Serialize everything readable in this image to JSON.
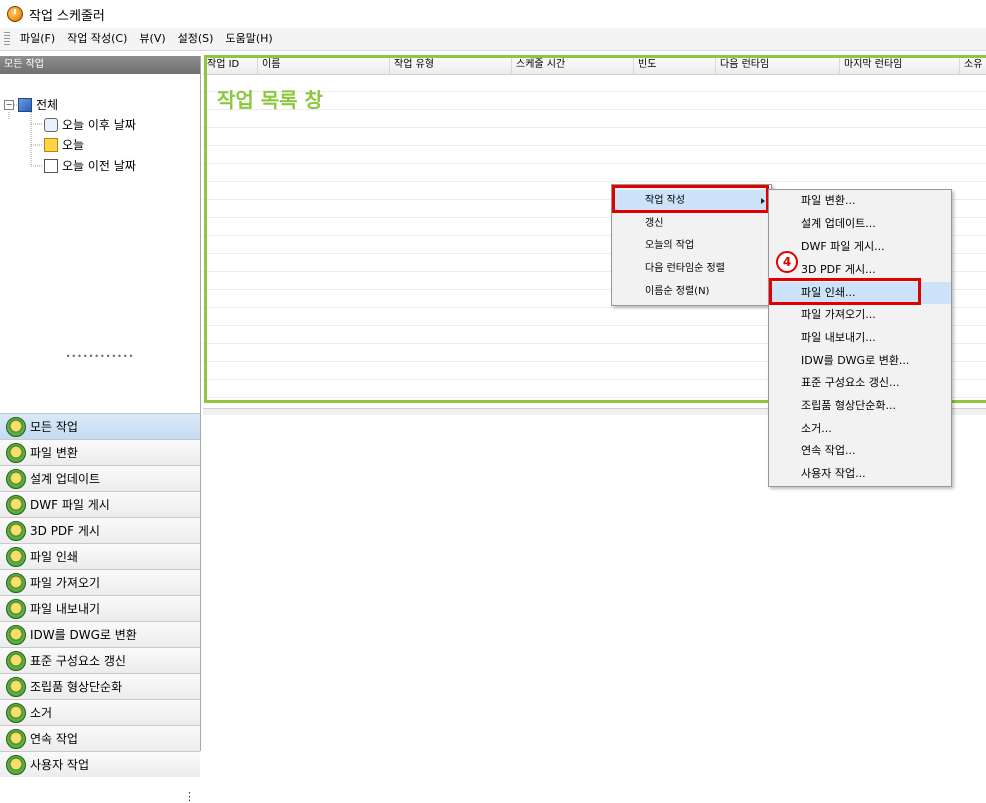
{
  "window": {
    "title": "작업 스케줄러"
  },
  "menubar": [
    "파일(F)",
    "작업 작성(C)",
    "뷰(V)",
    "설정(S)",
    "도움말(H)"
  ],
  "left_panel": {
    "header": "모든 작업",
    "tree": {
      "root": "전체",
      "children": [
        "오늘 이후 날짜",
        "오늘",
        "오늘 이전 날짜"
      ]
    },
    "tasks": [
      "모든 작업",
      "파일 변환",
      "설계 업데이트",
      "DWF 파일 게시",
      "3D PDF 게시",
      "파일 인쇄",
      "파일 가져오기",
      "파일 내보내기",
      "IDW를 DWG로 변환",
      "표준 구성요소 갱신",
      "조립품 형상단순화",
      "소거",
      "연속 작업",
      "사용자 작업"
    ],
    "selected_task": "모든 작업"
  },
  "task_list": {
    "columns": [
      "작업 ID",
      "이름",
      "작업 유형",
      "스케줄 시간",
      "빈도",
      "다음 런타임",
      "마지막 런타임",
      "소유"
    ],
    "overlay_label": "작업 목록 창"
  },
  "context_menu": {
    "items": [
      "작업 작성",
      "갱신",
      "오늘의 작업",
      "다음 런타임순 정렬",
      "이름순 정렬(N)"
    ],
    "highlighted": "작업 작성"
  },
  "submenu": {
    "items": [
      "파일 변환...",
      "설계 업데이트...",
      "DWF 파일 게시...",
      "3D PDF 게시...",
      "파일 인쇄...",
      "파일 가져오기...",
      "파일 내보내기...",
      "IDW를 DWG로 변환...",
      "표준 구성요소 갱신...",
      "조립품 형상단순화...",
      "소거...",
      "연속 작업...",
      "사용자 작업..."
    ],
    "highlighted": "파일 인쇄..."
  },
  "annotation": {
    "step": "4"
  },
  "colors": {
    "highlight_green": "#8dc63f",
    "highlight_red": "#e00000",
    "menu_hover": "#cde3fa"
  }
}
